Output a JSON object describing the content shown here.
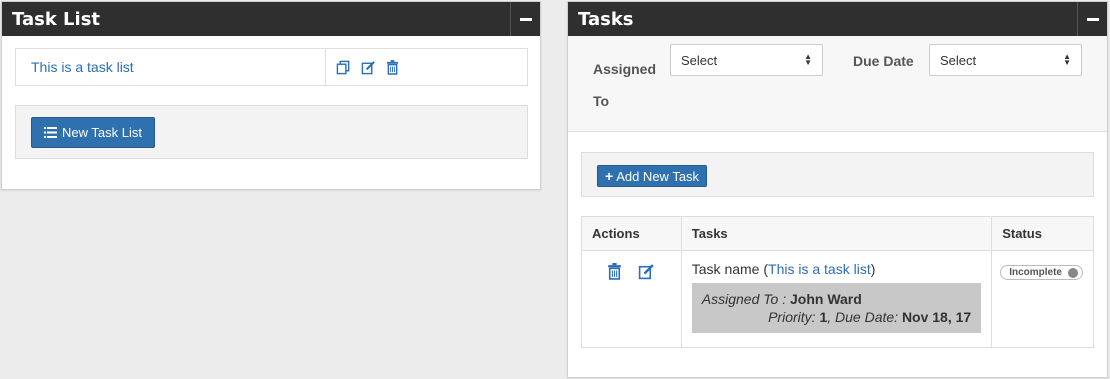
{
  "task_list_panel": {
    "title": "Task List",
    "item_name": "This is a task list",
    "new_button_label": "New Task List"
  },
  "tasks_panel": {
    "title": "Tasks",
    "filters": {
      "assigned_label": "Assigned To",
      "assigned_value": "Select",
      "due_label": "Due Date",
      "due_value": "Select"
    },
    "add_button_label": "Add New Task",
    "table": {
      "headers": [
        "Actions",
        "Tasks",
        "Status"
      ],
      "rows": [
        {
          "task_prefix": "Task name (",
          "task_list_link": "This is a task list",
          "task_suffix": ")",
          "assigned_label": "Assigned To : ",
          "assigned_name": "John Ward",
          "priority_label": "Priority: ",
          "priority_value": "1",
          "due_label": ", Due Date: ",
          "due_value": "Nov 18, 17",
          "status": "Incomplete"
        }
      ]
    }
  },
  "colors": {
    "header_bg": "#2f2f2f",
    "link": "#2a6ebb",
    "primary_button": "#2f70af"
  },
  "icons": [
    "minus-icon",
    "copy-icon",
    "edit-icon",
    "trash-icon",
    "list-icon",
    "plus-icon",
    "sort-arrows-icon"
  ]
}
